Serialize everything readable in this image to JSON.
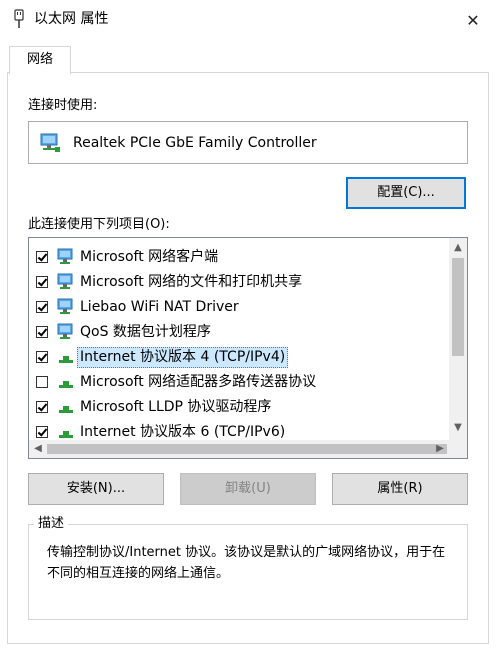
{
  "window": {
    "title": "以太网 属性"
  },
  "tabs": [
    {
      "label": "网络"
    }
  ],
  "connect_using": {
    "label": "连接时使用:",
    "adapter": "Realtek PCIe GbE Family Controller",
    "configure_button": "配置(C)..."
  },
  "items_section": {
    "label": "此连接使用下列项目(O):",
    "items": [
      {
        "label": "Microsoft 网络客户端",
        "checked": true,
        "icon": "network-client-icon",
        "selected": false
      },
      {
        "label": "Microsoft 网络的文件和打印机共享",
        "checked": true,
        "icon": "network-share-icon",
        "selected": false
      },
      {
        "label": "Liebao WiFi NAT Driver",
        "checked": true,
        "icon": "network-driver-icon",
        "selected": false
      },
      {
        "label": "QoS 数据包计划程序",
        "checked": true,
        "icon": "network-qos-icon",
        "selected": false
      },
      {
        "label": "Internet 协议版本 4 (TCP/IPv4)",
        "checked": true,
        "icon": "protocol-icon",
        "selected": true
      },
      {
        "label": "Microsoft 网络适配器多路传送器协议",
        "checked": false,
        "icon": "protocol-icon",
        "selected": false
      },
      {
        "label": "Microsoft LLDP 协议驱动程序",
        "checked": true,
        "icon": "protocol-icon",
        "selected": false
      },
      {
        "label": "Internet 协议版本 6 (TCP/IPv6)",
        "checked": true,
        "icon": "protocol-icon",
        "selected": false
      }
    ]
  },
  "buttons": {
    "install": "安装(N)...",
    "uninstall": "卸载(U)",
    "properties": "属性(R)"
  },
  "description": {
    "title": "描述",
    "text": "传输控制协议/Internet 协议。该协议是默认的广域网络协议，用于在不同的相互连接的网络上通信。"
  },
  "icons": {
    "close": "✕",
    "scroll_up": "▲",
    "scroll_down": "▼",
    "scroll_left": "◀",
    "scroll_right": "▶"
  },
  "colors": {
    "selection_bg": "#cce8ff",
    "accent": "#0078d7",
    "protocol_green": "#2e9b3a",
    "network_blue": "#3a8fd6"
  }
}
